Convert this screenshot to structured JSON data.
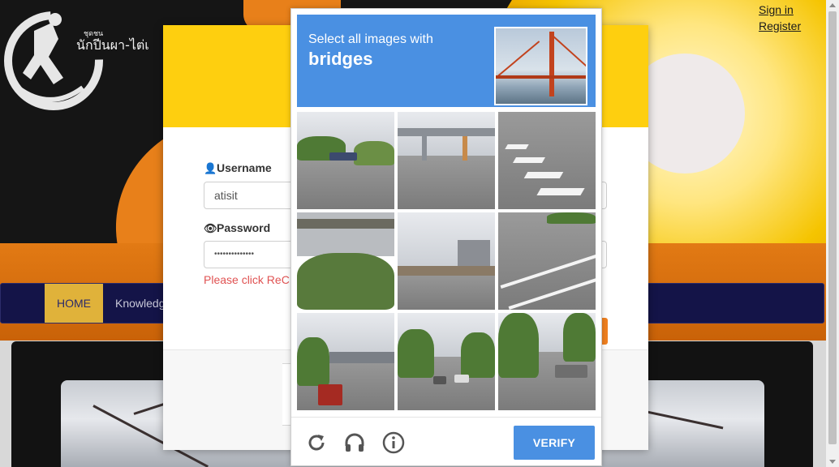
{
  "site": {
    "thai_title": "นักปีนผา-ไต่เ",
    "thai_sub": "ชุดชน",
    "sign_in": "Sign in",
    "register": "Register",
    "nav": {
      "home": "HOME",
      "knowledge": "Knowledg"
    }
  },
  "login": {
    "username_label": "Username",
    "username_value": "atisit",
    "password_label": "Password",
    "password_value": "••••••••••••••",
    "error_text": "Please click ReC",
    "forgot_link": "?"
  },
  "captcha": {
    "instruction": "Select all images with",
    "target": "bridges",
    "verify_label": "VERIFY",
    "icons": [
      "reload-icon",
      "audio-icon",
      "info-icon"
    ]
  },
  "colors": {
    "captcha_blue": "#4a90e2",
    "modal_header_yellow": "#fecf0f",
    "navbar_navy": "#141448",
    "error_red": "#e05252"
  }
}
